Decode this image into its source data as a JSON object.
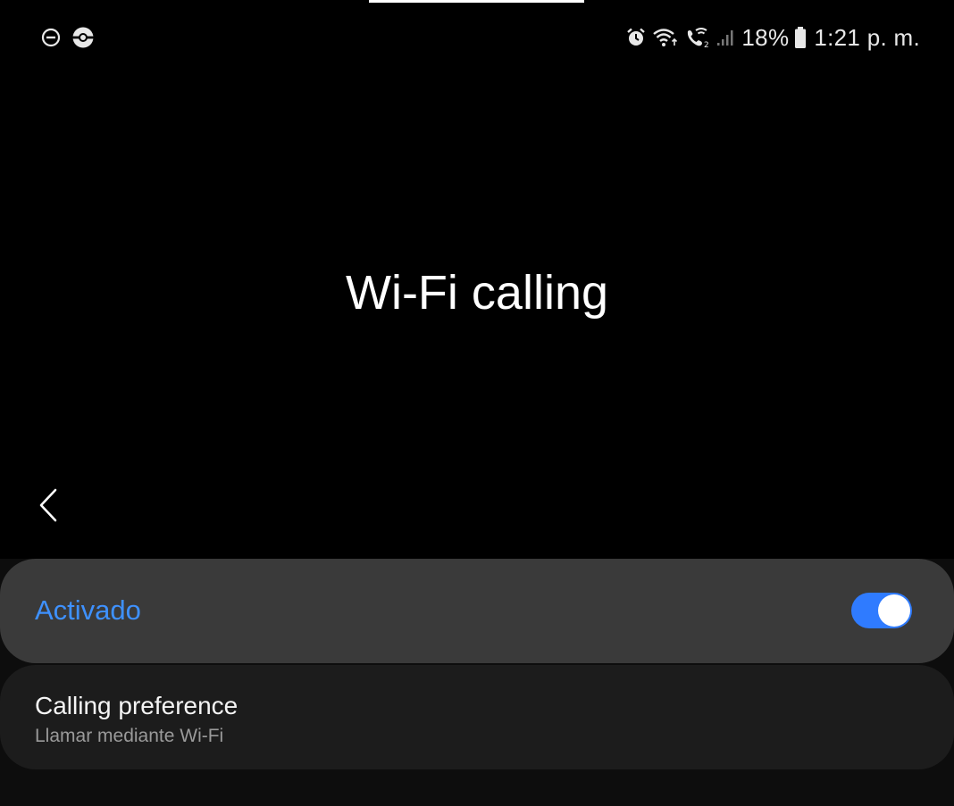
{
  "status_bar": {
    "left_icons": [
      "do-not-disturb-icon",
      "pokeball-icon"
    ],
    "right_icons": [
      "alarm-icon",
      "wifi-icon",
      "wifi-call-icon",
      "signal-icon",
      "battery-icon"
    ],
    "battery_percent": "18%",
    "time": "1:21 p. m."
  },
  "header": {
    "title": "Wi-Fi calling",
    "back_icon": "chevron-left-icon"
  },
  "toggle_row": {
    "label": "Activado",
    "enabled": true,
    "accent_color": "#3e91ff"
  },
  "preference_row": {
    "title": "Calling preference",
    "subtitle": "Llamar mediante Wi-Fi"
  },
  "colors": {
    "background": "#000000",
    "toggle_card": "#3a3a3a",
    "preference_card": "#1c1c1c",
    "switch_on": "#2f7bff"
  }
}
